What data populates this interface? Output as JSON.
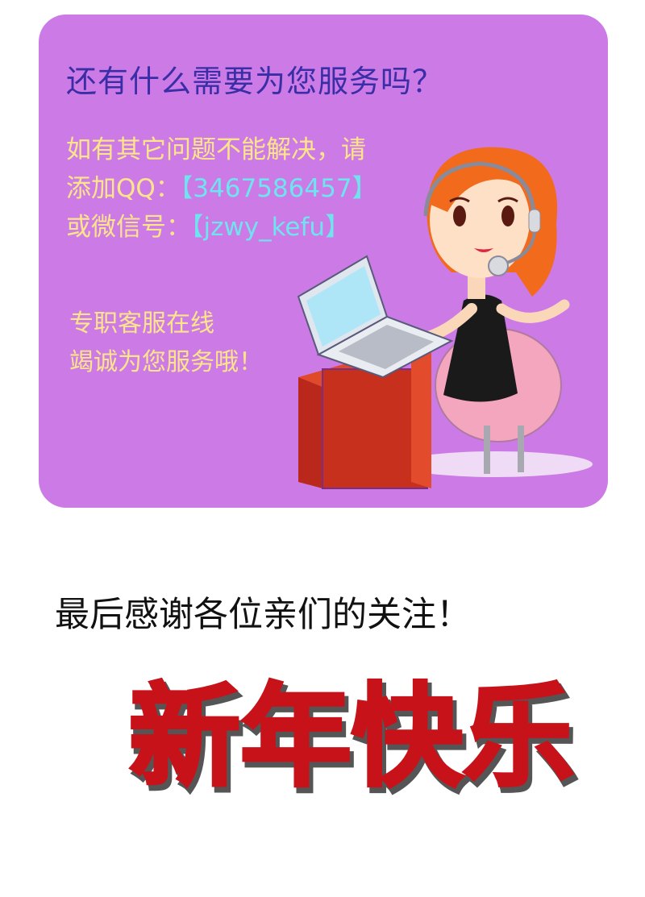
{
  "panel": {
    "heading": "还有什么需要为您服务吗？",
    "contact_line1": "如有其它问题不能解决，请",
    "qq_prefix": "添加QQ：",
    "qq_value": "【3467586457】",
    "wechat_prefix": "或微信号：",
    "wechat_value": "【jzwy_kefu】",
    "slogan_line1": "专职客服在线",
    "slogan_line2": "竭诚为您服务哦！",
    "colors": {
      "background": "#cb7ae6",
      "heading": "#3a2ea6",
      "text": "#ffe58a",
      "accent": "#6fe4ef"
    }
  },
  "footer": {
    "thanks": "最后感谢各位亲们的关注！",
    "greeting": "新年快乐",
    "greeting_color": "#c8121a"
  },
  "illustration": {
    "icon": "customer-service-agent-icon"
  }
}
